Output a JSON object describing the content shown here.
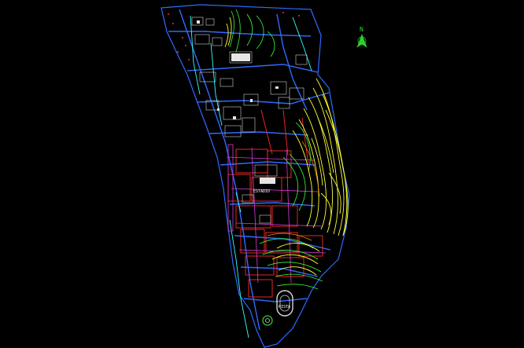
{
  "north_arrow": {
    "label": "N"
  },
  "map": {
    "colors": {
      "background": "#000000",
      "roads": "#2f6bff",
      "parcels_red": "#ff2a2a",
      "parcels_magenta": "#d63bd6",
      "contours_yellow": "#ffff33",
      "contours_green": "#39ff39",
      "buildings": "#cfcfcf",
      "cyan": "#33ffff",
      "orange": "#ff8a00"
    },
    "labels": {
      "central_block": "ESTADIO",
      "stadium": "PISTA"
    }
  }
}
